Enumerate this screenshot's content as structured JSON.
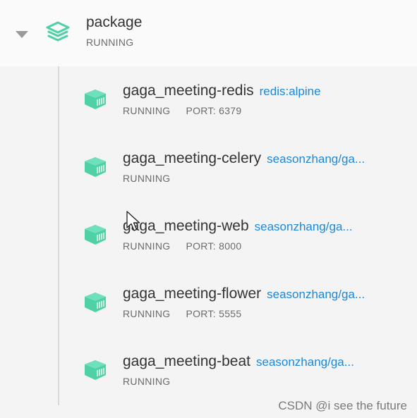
{
  "package": {
    "name": "package",
    "status": "RUNNING"
  },
  "containers": [
    {
      "name": "gaga_meeting-redis",
      "image": "redis:alpine",
      "status": "RUNNING",
      "port": "PORT: 6379"
    },
    {
      "name": "gaga_meeting-celery",
      "image": "seasonzhang/ga...",
      "status": "RUNNING",
      "port": ""
    },
    {
      "name": "gaga_meeting-web",
      "image": "seasonzhang/ga...",
      "status": "RUNNING",
      "port": "PORT: 8000"
    },
    {
      "name": "gaga_meeting-flower",
      "image": "seasonzhang/ga...",
      "status": "RUNNING",
      "port": "PORT: 5555"
    },
    {
      "name": "gaga_meeting-beat",
      "image": "seasonzhang/ga...",
      "status": "RUNNING",
      "port": ""
    }
  ],
  "watermark": "CSDN @i see the future",
  "colors": {
    "accent": "#4fd1a5",
    "link": "#1e88d8",
    "text": "#333333",
    "muted": "#6b6b6b"
  },
  "icons": {
    "collapse": "caret-down-icon",
    "package": "layers-icon",
    "container": "container-icon"
  }
}
